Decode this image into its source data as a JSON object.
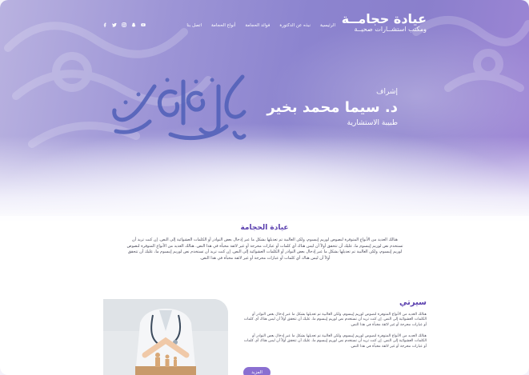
{
  "header": {
    "brand_title": "عيادة حجامــة",
    "brand_subtitle": "ومكتب استشــارات صحيــة",
    "nav": [
      "الرئيسية",
      "نبذه عن الدكتورة",
      "فوائد الحجامة",
      "أنواع الحجامة",
      "اتصل بنا"
    ],
    "social": [
      "youtube-icon",
      "snapchat-icon",
      "instagram-icon",
      "twitter-icon",
      "facebook-icon"
    ]
  },
  "hero": {
    "supervision": "إشراف",
    "doctor_name": "د. سيما محمد بخير",
    "doctor_role": "طبيبة الاستشارية",
    "calligraphy_text": "فإن هو فيه وإذا مرضت فهو يشفين"
  },
  "about": {
    "title": "عيادة الحجامة",
    "text": "هنالك العديد من الأنواع المتوفرة لنصوص لوريم إيبسوم، ولكن الغالبية تم تعديلها بشكل ما عبر إدخال بعض النوادر أو الكلمات العشوائية إلى النص. إن كنت تريد أن تستخدم نص لوريم إيبسوم ما، عليك أن تتحقق أولاً أن ليس هناك أي كلمات أو عبارات محرجة أو غير لائقة مخبأة في هذا النص. هنالك العديد من الأنواع المتوفرة لنصوص لوريم إيبسوم، ولكن الغالبية تم تعديلها بشكل ما عبر إدخال بعض النوادر أو الكلمات العشوائية إلى النص. إن كنت تريد أن تستخدم نص لوريم إيبسوم ما، عليك أن تتحقق أولاً أن ليس هناك أي كلمات أو عبارات محرجة أو غير لائقة مخبأة في هذا النص."
  },
  "bio": {
    "title": "سيرتي",
    "paragraph1": "هنالك العديد من الأنواع المتوفرة لنصوص لوريم إيبسوم، ولكن الغالبية تم تعديلها بشكل ما عبر إدخال بعض النوادر أو الكلمات العشوائية إلى النص. إن كنت تريد أن تستخدم نص لوريم إيبسوم ما، عليك أن تتحقق أولاً أن ليس هناك أي كلمات أو عبارات محرجة أو غير لائقة مخبأة في هذا النص.",
    "paragraph2": "هنالك العديد من الأنواع المتوفرة لنصوص لوريم إيبسوم، ولكن الغالبية تم تعديلها بشكل ما عبر إدخال بعض النوادر أو الكلمات العشوائية إلى النص. إن كنت تريد أن تستخدم نص لوريم إيبسوم ما، عليك أن تتحقق أولاً أن ليس هناك أي كلمات أو عبارات محرجة أو غير لائقة مخبأة في هذا النص.",
    "more_label": "المزيد"
  },
  "colors": {
    "accent": "#5a3fae",
    "button": "#8a6fd1",
    "hero_purple": "#8c84cf"
  }
}
